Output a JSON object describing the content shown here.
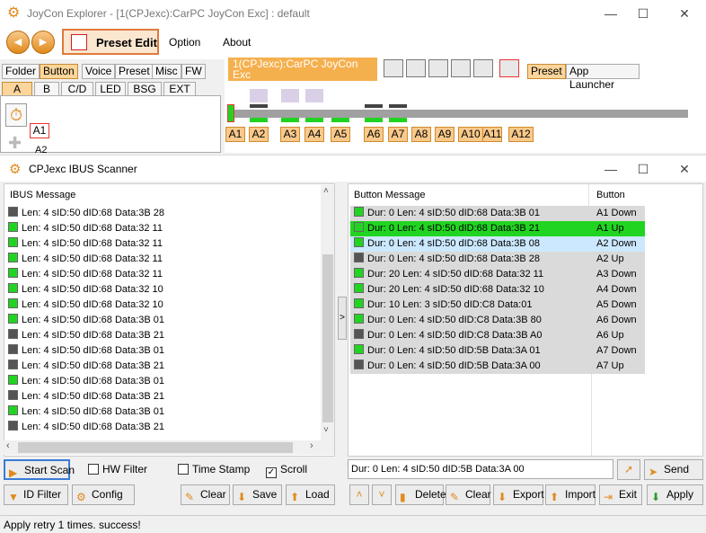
{
  "main_window": {
    "title": "JoyCon Explorer - [1(CPJexc):CarPC JoyCon Exc] : default",
    "minimize": "—",
    "maximize": "☐",
    "close": "✕"
  },
  "toolbar": {
    "back": "◀",
    "forward": "▶",
    "preset_edit": "Preset Edit",
    "menu": [
      "Option",
      "About"
    ]
  },
  "left_tabs": [
    "Folder",
    "Button",
    "Voice",
    "Preset",
    "Misc",
    "FW"
  ],
  "left_subtabs": [
    "A",
    "B",
    "C/D",
    "LED",
    "BSG",
    "EXT"
  ],
  "left_panel": {
    "item1": "A1",
    "item2": "A2"
  },
  "profile_tab": {
    "line1": "1(CPJexc):CarPC JoyCon Exc",
    "line2": "default"
  },
  "right_tabs": [
    "Preset",
    "App Launcher"
  ],
  "button_boxes": [
    "A1",
    "A2",
    "A3",
    "A4",
    "A5",
    "A6",
    "A7",
    "A8",
    "A9",
    "A10",
    "A11",
    "A12"
  ],
  "dialog": {
    "title": "CPJexc IBUS Scanner",
    "minimize": "—",
    "maximize": "☐",
    "close": "✕"
  },
  "ibus": {
    "header": "IBUS Message",
    "rows": [
      {
        "t": "Len: 4 sID:50 dID:68 Data:3B 28",
        "c": "d"
      },
      {
        "t": "Len: 4 sID:50 dID:68 Data:32 11",
        "c": "g"
      },
      {
        "t": "Len: 4 sID:50 dID:68 Data:32 11",
        "c": "g"
      },
      {
        "t": "Len: 4 sID:50 dID:68 Data:32 11",
        "c": "g"
      },
      {
        "t": "Len: 4 sID:50 dID:68 Data:32 11",
        "c": "g"
      },
      {
        "t": "Len: 4 sID:50 dID:68 Data:32 10",
        "c": "g"
      },
      {
        "t": "Len: 4 sID:50 dID:68 Data:32 10",
        "c": "g"
      },
      {
        "t": "Len: 4 sID:50 dID:68 Data:3B 01",
        "c": "g"
      },
      {
        "t": "Len: 4 sID:50 dID:68 Data:3B 21",
        "c": "d"
      },
      {
        "t": "Len: 4 sID:50 dID:68 Data:3B 01",
        "c": "d"
      },
      {
        "t": "Len: 4 sID:50 dID:68 Data:3B 21",
        "c": "d"
      },
      {
        "t": "Len: 4 sID:50 dID:68 Data:3B 01",
        "c": "g"
      },
      {
        "t": "Len: 4 sID:50 dID:68 Data:3B 21",
        "c": "d"
      },
      {
        "t": "Len: 4 sID:50 dID:68 Data:3B 01",
        "c": "g"
      },
      {
        "t": "Len: 4 sID:50 dID:68 Data:3B 21",
        "c": "d"
      }
    ]
  },
  "button_list": {
    "header_msg": "Button Message",
    "header_btn": "Button",
    "rows": [
      {
        "m": "Dur:  0 Len: 4 sID:50 dID:68 Data:3B 01",
        "b": "A1 Down",
        "c": "g",
        "hl": ""
      },
      {
        "m": "Dur:  0 Len: 4 sID:50 dID:68 Data:3B 21",
        "b": "A1 Up",
        "c": "g",
        "hl": "green"
      },
      {
        "m": "Dur:  0 Len: 4 sID:50 dID:68 Data:3B 08",
        "b": "A2 Down",
        "c": "g",
        "hl": "blue"
      },
      {
        "m": "Dur:  0 Len: 4 sID:50 dID:68 Data:3B 28",
        "b": "A2 Up",
        "c": "d",
        "hl": ""
      },
      {
        "m": "Dur: 20 Len: 4 sID:50 dID:68 Data:32 11",
        "b": "A3 Down",
        "c": "g",
        "hl": ""
      },
      {
        "m": "Dur: 20 Len: 4 sID:50 dID:68 Data:32 10",
        "b": "A4 Down",
        "c": "g",
        "hl": ""
      },
      {
        "m": "Dur: 10 Len: 3 sID:50 dID:C8 Data:01",
        "b": "A5 Down",
        "c": "g",
        "hl": ""
      },
      {
        "m": "Dur:  0 Len: 4 sID:50 dID:C8 Data:3B 80",
        "b": "A6 Down",
        "c": "g",
        "hl": ""
      },
      {
        "m": "Dur:  0 Len: 4 sID:50 dID:C8 Data:3B A0",
        "b": "A6 Up",
        "c": "d",
        "hl": ""
      },
      {
        "m": "Dur:  0 Len: 4 sID:50 dID:5B Data:3A 01",
        "b": "A7 Down",
        "c": "g",
        "hl": ""
      },
      {
        "m": "Dur:  0 Len: 4 sID:50 dID:5B Data:3A 00",
        "b": "A7 Up",
        "c": "d",
        "hl": ""
      }
    ]
  },
  "send_field": "Dur:  0 Len: 4 sID:50 dID:5B Data:3A 00",
  "controls": {
    "start_scan": "Start Scan",
    "hw_filter": "HW Filter",
    "time_stamp": "Time Stamp",
    "scroll": "Scroll",
    "id_filter": "ID Filter",
    "config": "Config",
    "clear": "Clear",
    "save": "Save",
    "load": "Load",
    "send": "Send",
    "delete": "Delete",
    "clear2": "Clear",
    "export": "Export",
    "import": "Import",
    "exit": "Exit",
    "apply": "Apply"
  },
  "status_text": "Apply retry  1 times. success!",
  "colors": {
    "accent": "#e08a1c",
    "green": "#22d422",
    "selected_blue": "#cce8ff"
  }
}
